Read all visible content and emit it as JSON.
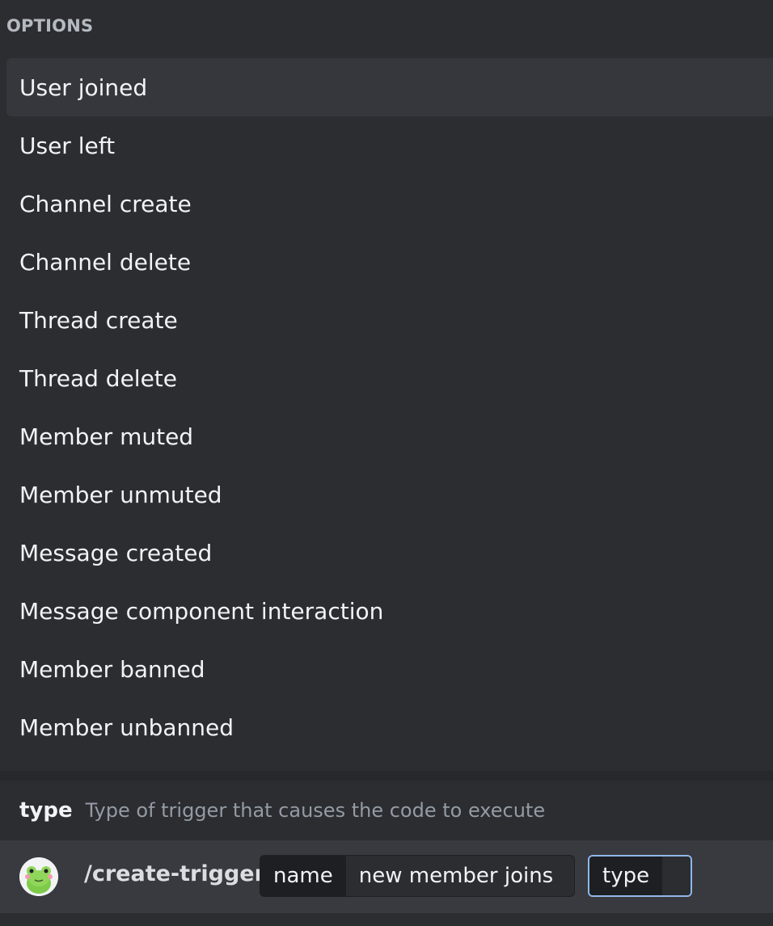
{
  "options": {
    "header": "OPTIONS",
    "items": [
      {
        "label": "User joined",
        "selected": true
      },
      {
        "label": "User left"
      },
      {
        "label": "Channel create"
      },
      {
        "label": "Channel delete"
      },
      {
        "label": "Thread create"
      },
      {
        "label": "Thread delete"
      },
      {
        "label": "Member muted"
      },
      {
        "label": "Member unmuted"
      },
      {
        "label": "Message created"
      },
      {
        "label": "Message component interaction"
      },
      {
        "label": "Member banned"
      },
      {
        "label": "Member unbanned"
      }
    ]
  },
  "hint": {
    "param_name": "type",
    "description": "Type of trigger that causes the code to execute"
  },
  "composer": {
    "command": "/create-trigger",
    "params": [
      {
        "key": "name",
        "value": "new member joins"
      },
      {
        "key": "type",
        "value": ""
      }
    ],
    "avatar_icon": "frog-avatar-icon"
  },
  "colors": {
    "background": "#2b2d31",
    "selected_row": "#35373c",
    "composer": "#383a40",
    "focus_border": "#8fb8e8",
    "muted_text": "#949ba4"
  }
}
